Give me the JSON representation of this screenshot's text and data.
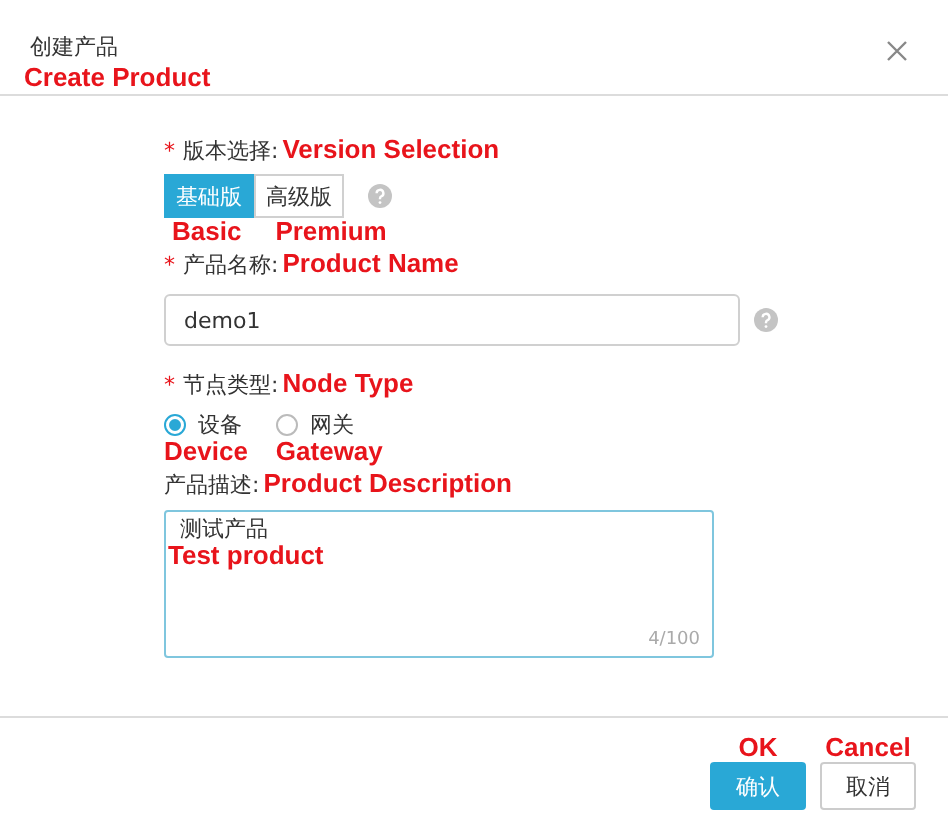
{
  "dialog": {
    "title": "创建产品",
    "title_note": "Create Product"
  },
  "version": {
    "marker": "*",
    "label": "版本选择:",
    "note": "Version Selection",
    "options": [
      {
        "label": "基础版",
        "note": "Basic",
        "selected": true
      },
      {
        "label": "高级版",
        "note": "Premium",
        "selected": false
      }
    ]
  },
  "product_name": {
    "marker": "*",
    "label": "产品名称:",
    "note": "Product Name",
    "value": "demo1"
  },
  "node_type": {
    "marker": "*",
    "label": "节点类型:",
    "note": "Node Type",
    "options": [
      {
        "label": "设备",
        "note": "Device",
        "selected": true
      },
      {
        "label": "网关",
        "note": "Gateway",
        "selected": false
      }
    ]
  },
  "description": {
    "label": "产品描述:",
    "note": "Product Description",
    "value": "测试产品",
    "value_note": "Test product",
    "counter": "4/100"
  },
  "buttons": [
    {
      "kind": "primary",
      "label": "确认",
      "note": "OK"
    },
    {
      "kind": "default",
      "label": "取消",
      "note": "Cancel"
    }
  ]
}
